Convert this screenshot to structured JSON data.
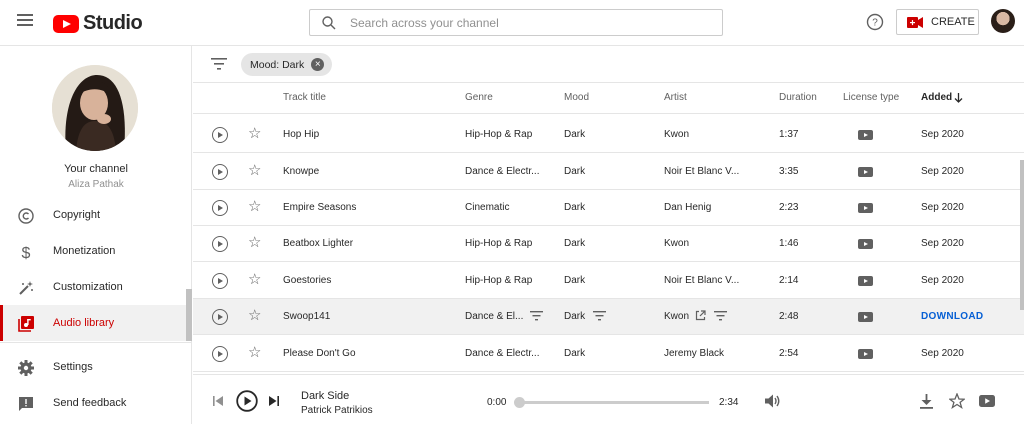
{
  "header": {
    "logo_text": "Studio",
    "search_placeholder": "Search across your channel",
    "create_label": "CREATE"
  },
  "sidebar": {
    "channel_title": "Your channel",
    "channel_name": "Aliza Pathak",
    "items": [
      {
        "label": "Copyright",
        "icon": "copyright-icon"
      },
      {
        "label": "Monetization",
        "icon": "dollar-icon"
      },
      {
        "label": "Customization",
        "icon": "magic-wand-icon"
      },
      {
        "label": "Audio library",
        "icon": "audio-library-icon",
        "active": true
      },
      {
        "label": "Settings",
        "icon": "gear-icon"
      },
      {
        "label": "Send feedback",
        "icon": "feedback-icon"
      }
    ]
  },
  "filter": {
    "chip_label": "Mood: Dark"
  },
  "table": {
    "columns": {
      "title": "Track title",
      "genre": "Genre",
      "mood": "Mood",
      "artist": "Artist",
      "duration": "Duration",
      "license": "License type",
      "added": "Added"
    },
    "rows": [
      {
        "title": "Hop Hip",
        "genre": "Hip-Hop & Rap",
        "mood": "Dark",
        "artist": "Kwon",
        "duration": "1:37",
        "added": "Sep 2020"
      },
      {
        "title": "Knowpe",
        "genre": "Dance & Electr...",
        "mood": "Dark",
        "artist": "Noir Et Blanc V...",
        "duration": "3:35",
        "added": "Sep 2020"
      },
      {
        "title": "Empire Seasons",
        "genre": "Cinematic",
        "mood": "Dark",
        "artist": "Dan Henig",
        "duration": "2:23",
        "added": "Sep 2020"
      },
      {
        "title": "Beatbox Lighter",
        "genre": "Hip-Hop & Rap",
        "mood": "Dark",
        "artist": "Kwon",
        "duration": "1:46",
        "added": "Sep 2020"
      },
      {
        "title": "Goestories",
        "genre": "Hip-Hop & Rap",
        "mood": "Dark",
        "artist": "Noir Et Blanc V...",
        "duration": "2:14",
        "added": "Sep 2020"
      },
      {
        "title": "Swoop141",
        "genre": "Dance & El...",
        "mood": "Dark",
        "artist": "Kwon",
        "duration": "2:48",
        "added": "DOWNLOAD"
      },
      {
        "title": "Please Don't Go",
        "genre": "Dance & Electr...",
        "mood": "Dark",
        "artist": "Jeremy Black",
        "duration": "2:54",
        "added": "Sep 2020"
      }
    ]
  },
  "player": {
    "title": "Dark Side",
    "artist": "Patrick Patrikios",
    "current_time": "0:00",
    "total_time": "2:34",
    "progress_percent": 0
  },
  "colors": {
    "accent": "#cc0000",
    "link": "#065fd4"
  }
}
